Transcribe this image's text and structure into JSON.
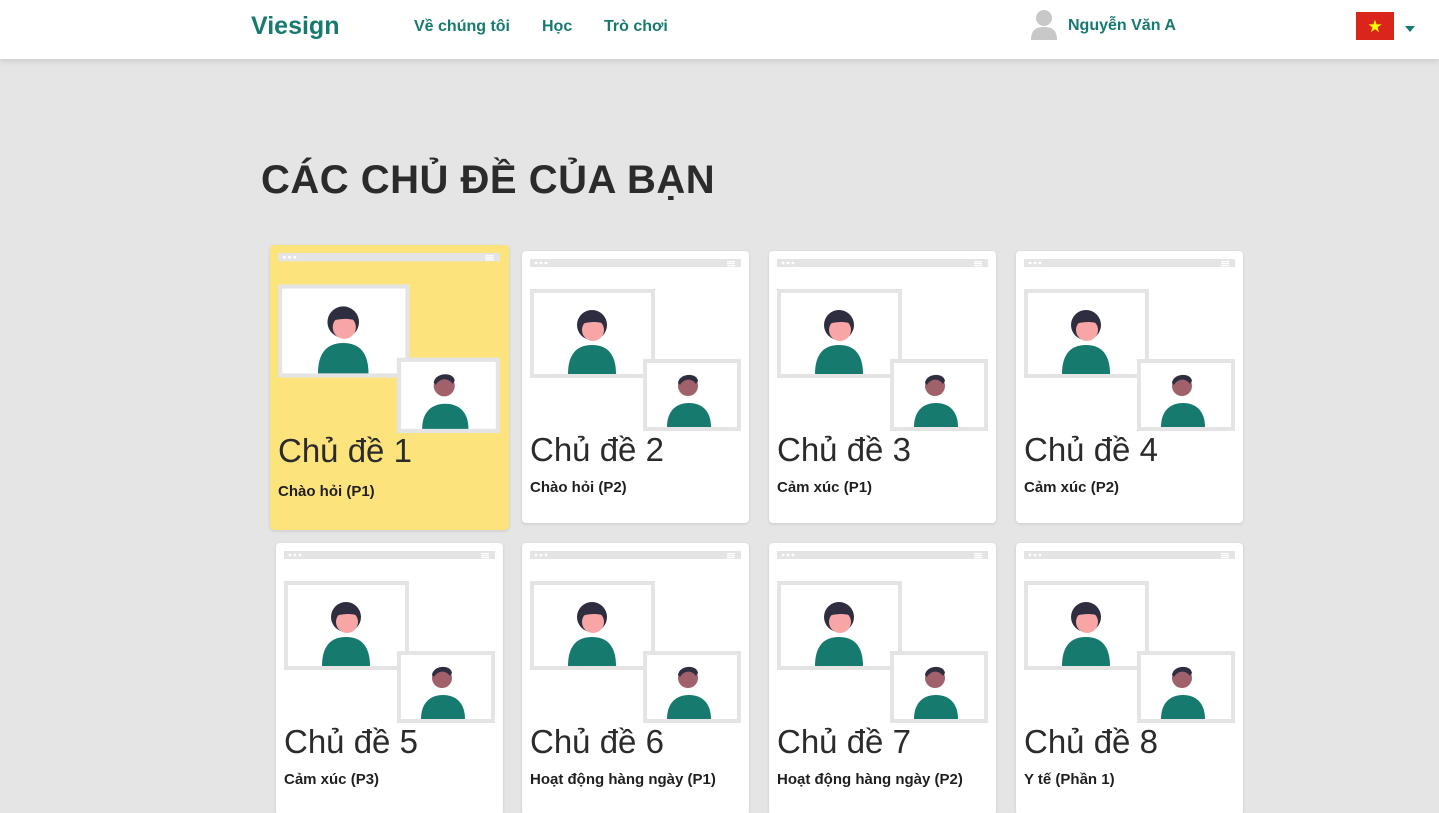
{
  "navbar": {
    "brand": "Viesign",
    "links": [
      {
        "label": "Về chúng tôi"
      },
      {
        "label": "Học"
      },
      {
        "label": "Trò chơi"
      }
    ],
    "user_name": "Nguyễn Văn A",
    "user_icon": "avatar-icon",
    "flag_icon": "vietnam-flag-icon"
  },
  "page_title": "CÁC CHỦ ĐỀ CỦA BẠN",
  "topics": [
    {
      "title": "Chủ đề 1",
      "subtitle": "Chào hỏi (P1)",
      "selected": true
    },
    {
      "title": "Chủ đề 2",
      "subtitle": "Chào hỏi (P2)",
      "selected": false
    },
    {
      "title": "Chủ đề 3",
      "subtitle": "Cảm xúc (P1)",
      "selected": false
    },
    {
      "title": "Chủ đề 4",
      "subtitle": "Cảm xúc (P2)",
      "selected": false
    },
    {
      "title": "Chủ đề 5",
      "subtitle": "Cảm xúc (P3)",
      "selected": false
    },
    {
      "title": "Chủ đề 6",
      "subtitle": "Hoạt động hàng ngày (P1)",
      "selected": false
    },
    {
      "title": "Chủ đề 7",
      "subtitle": "Hoạt động hàng ngày (P2)",
      "selected": false
    },
    {
      "title": "Chủ đề 8",
      "subtitle": "Y tế (Phần 1)",
      "selected": false
    }
  ],
  "colors": {
    "brand": "#167a6e",
    "selected_card": "#fde37c",
    "page_background": "#e5e5e5",
    "figure_shirt": "#167a6e",
    "figure_hair": "#2f2e41",
    "figure_skin": "#f7a5a5"
  }
}
